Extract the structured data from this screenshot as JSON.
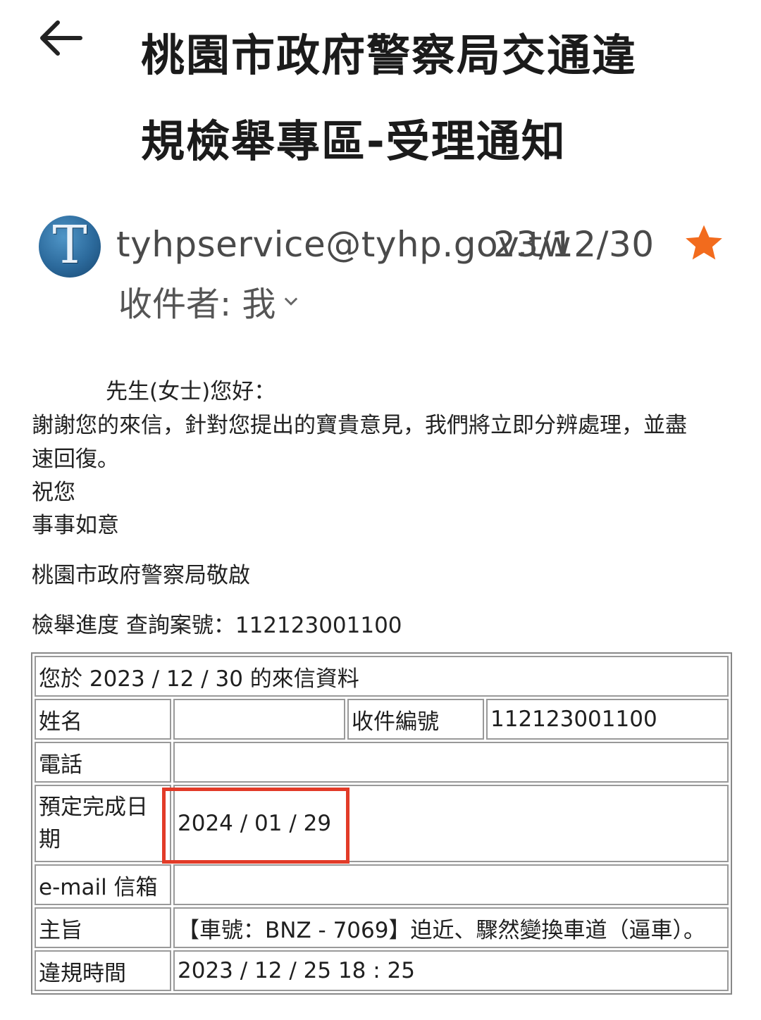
{
  "header": {
    "back_icon": "arrow-left-icon",
    "subject_line1": "桃園市政府警察局交通違",
    "subject_line2": "規檢舉專區-受理通知"
  },
  "sender": {
    "avatar_letter": "T",
    "email": "tyhpservice@tyhp.gov.tw",
    "date": "23/12/30",
    "star_icon": "star-icon",
    "star_color": "#f26b1d",
    "recipient": "收件者: 我",
    "chevron_icon": "chevron-down-icon"
  },
  "body": {
    "greeting": "先生(女士)您好：",
    "para1_line1": "謝謝您的來信，針對您提出的寶貴意見，我們將立即分辨處理，並盡",
    "para1_line2": "速回復。",
    "closing1": "祝您",
    "closing2": "事事如意",
    "signature": "桃園市政府警察局敬啟",
    "case_query": "檢舉進度 查詢案號：112123001100"
  },
  "table": {
    "caption": "您於 2023 / 12 / 30 的來信資料",
    "name_label": "姓名",
    "name_value": "",
    "receipt_label": "收件編號",
    "receipt_value": "112123001100",
    "phone_label": "電話",
    "phone_value": "",
    "due_label": "預定完成日期",
    "due_value": "2024 / 01 / 29",
    "email_label": "e-mail 信箱",
    "email_value": "",
    "subject_label": "主旨",
    "subject_value": "【車號：BNZ - 7069】迫近、驟然變換車道（逼車）。",
    "time_label": "違規時間",
    "time_value": "2023 / 12 / 25 18 : 25",
    "highlight_color": "#e23b28"
  }
}
